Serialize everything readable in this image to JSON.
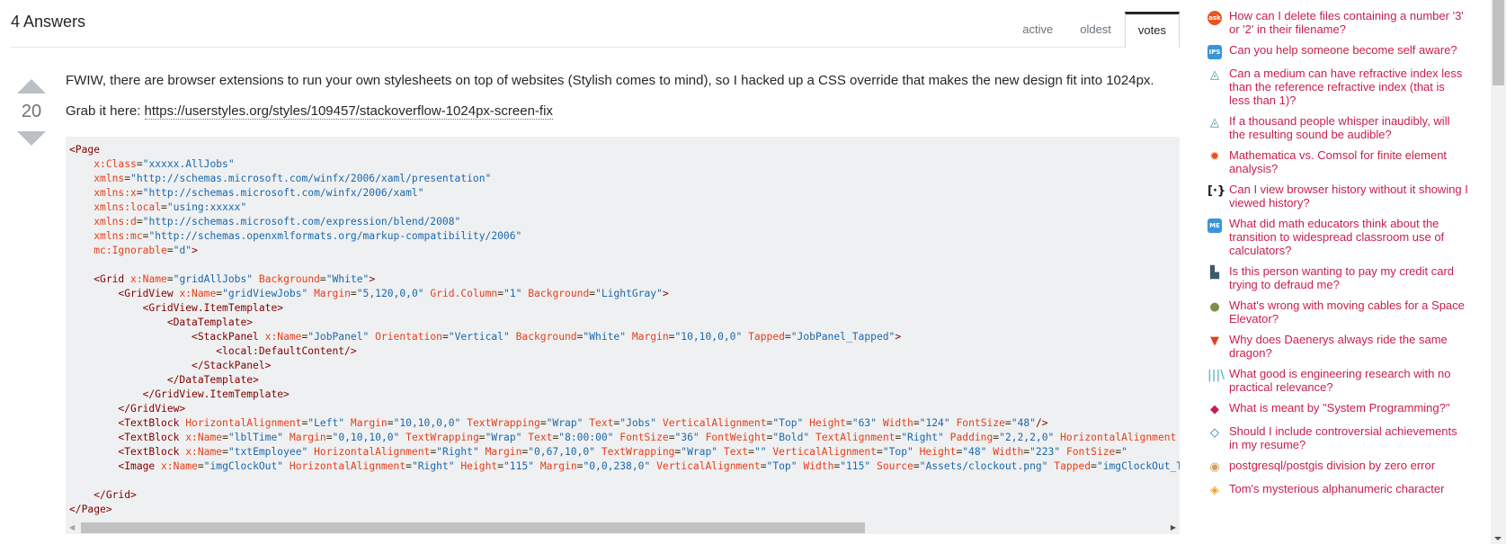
{
  "answers": {
    "title": "4 Answers",
    "tabs": [
      {
        "label": "active",
        "selected": false
      },
      {
        "label": "oldest",
        "selected": false
      },
      {
        "label": "votes",
        "selected": true
      }
    ]
  },
  "answer": {
    "vote_count": "20",
    "paragraph_1": "FWIW, there are browser extensions to run your own stylesheets on top of websites (Stylish comes to mind), so I hacked up a CSS override that makes the new design fit into 1024px.",
    "grab_prefix": "Grab it here: ",
    "link_text": "https://userstyles.org/styles/109457/stackoverflow-1024px-screen-fix",
    "code_lines": [
      [
        [
          "tg",
          "<Page"
        ]
      ],
      [
        [
          "p",
          "    "
        ],
        [
          "at",
          "x:Class"
        ],
        [
          "p",
          "="
        ],
        [
          "st",
          "\"xxxxx.AllJobs\""
        ]
      ],
      [
        [
          "p",
          "    "
        ],
        [
          "at",
          "xmlns"
        ],
        [
          "p",
          "="
        ],
        [
          "st",
          "\"http://schemas.microsoft.com/winfx/2006/xaml/presentation\""
        ]
      ],
      [
        [
          "p",
          "    "
        ],
        [
          "at",
          "xmlns:x"
        ],
        [
          "p",
          "="
        ],
        [
          "st",
          "\"http://schemas.microsoft.com/winfx/2006/xaml\""
        ]
      ],
      [
        [
          "p",
          "    "
        ],
        [
          "at",
          "xmlns:local"
        ],
        [
          "p",
          "="
        ],
        [
          "st",
          "\"using:xxxxx\""
        ]
      ],
      [
        [
          "p",
          "    "
        ],
        [
          "at",
          "xmlns:d"
        ],
        [
          "p",
          "="
        ],
        [
          "st",
          "\"http://schemas.microsoft.com/expression/blend/2008\""
        ]
      ],
      [
        [
          "p",
          "    "
        ],
        [
          "at",
          "xmlns:mc"
        ],
        [
          "p",
          "="
        ],
        [
          "st",
          "\"http://schemas.openxmlformats.org/markup-compatibility/2006\""
        ]
      ],
      [
        [
          "p",
          "    "
        ],
        [
          "at",
          "mc:Ignorable"
        ],
        [
          "p",
          "="
        ],
        [
          "st",
          "\"d\""
        ],
        [
          "tg",
          ">"
        ]
      ],
      [
        [
          "p",
          ""
        ]
      ],
      [
        [
          "p",
          "    "
        ],
        [
          "tg",
          "<Grid"
        ],
        [
          "p",
          " "
        ],
        [
          "at",
          "x:Name"
        ],
        [
          "p",
          "="
        ],
        [
          "st",
          "\"gridAllJobs\""
        ],
        [
          "p",
          " "
        ],
        [
          "at",
          "Background"
        ],
        [
          "p",
          "="
        ],
        [
          "st",
          "\"White\""
        ],
        [
          "tg",
          ">"
        ]
      ],
      [
        [
          "p",
          "        "
        ],
        [
          "tg",
          "<GridView"
        ],
        [
          "p",
          " "
        ],
        [
          "at",
          "x:Name"
        ],
        [
          "p",
          "="
        ],
        [
          "st",
          "\"gridViewJobs\""
        ],
        [
          "p",
          " "
        ],
        [
          "at",
          "Margin"
        ],
        [
          "p",
          "="
        ],
        [
          "st",
          "\"5,120,0,0\""
        ],
        [
          "p",
          " "
        ],
        [
          "at",
          "Grid.Column"
        ],
        [
          "p",
          "="
        ],
        [
          "st",
          "\"1\""
        ],
        [
          "p",
          " "
        ],
        [
          "at",
          "Background"
        ],
        [
          "p",
          "="
        ],
        [
          "st",
          "\"LightGray\""
        ],
        [
          "tg",
          ">"
        ]
      ],
      [
        [
          "p",
          "            "
        ],
        [
          "tg",
          "<GridView.ItemTemplate>"
        ]
      ],
      [
        [
          "p",
          "                "
        ],
        [
          "tg",
          "<DataTemplate>"
        ]
      ],
      [
        [
          "p",
          "                    "
        ],
        [
          "tg",
          "<StackPanel"
        ],
        [
          "p",
          " "
        ],
        [
          "at",
          "x:Name"
        ],
        [
          "p",
          "="
        ],
        [
          "st",
          "\"JobPanel\""
        ],
        [
          "p",
          " "
        ],
        [
          "at",
          "Orientation"
        ],
        [
          "p",
          "="
        ],
        [
          "st",
          "\"Vertical\""
        ],
        [
          "p",
          " "
        ],
        [
          "at",
          "Background"
        ],
        [
          "p",
          "="
        ],
        [
          "st",
          "\"White\""
        ],
        [
          "p",
          " "
        ],
        [
          "at",
          "Margin"
        ],
        [
          "p",
          "="
        ],
        [
          "st",
          "\"10,10,0,0\""
        ],
        [
          "p",
          " "
        ],
        [
          "at",
          "Tapped"
        ],
        [
          "p",
          "="
        ],
        [
          "st",
          "\"JobPanel_Tapped\""
        ],
        [
          "tg",
          ">"
        ]
      ],
      [
        [
          "p",
          "                        "
        ],
        [
          "tg",
          "<local:DefaultContent/>"
        ]
      ],
      [
        [
          "p",
          "                    "
        ],
        [
          "tg",
          "</StackPanel>"
        ]
      ],
      [
        [
          "p",
          "                "
        ],
        [
          "tg",
          "</DataTemplate>"
        ]
      ],
      [
        [
          "p",
          "            "
        ],
        [
          "tg",
          "</GridView.ItemTemplate>"
        ]
      ],
      [
        [
          "p",
          "        "
        ],
        [
          "tg",
          "</GridView>"
        ]
      ],
      [
        [
          "p",
          "        "
        ],
        [
          "tg",
          "<TextBlock"
        ],
        [
          "p",
          " "
        ],
        [
          "at",
          "HorizontalAlignment"
        ],
        [
          "p",
          "="
        ],
        [
          "st",
          "\"Left\""
        ],
        [
          "p",
          " "
        ],
        [
          "at",
          "Margin"
        ],
        [
          "p",
          "="
        ],
        [
          "st",
          "\"10,10,0,0\""
        ],
        [
          "p",
          " "
        ],
        [
          "at",
          "TextWrapping"
        ],
        [
          "p",
          "="
        ],
        [
          "st",
          "\"Wrap\""
        ],
        [
          "p",
          " "
        ],
        [
          "at",
          "Text"
        ],
        [
          "p",
          "="
        ],
        [
          "st",
          "\"Jobs\""
        ],
        [
          "p",
          " "
        ],
        [
          "at",
          "VerticalAlignment"
        ],
        [
          "p",
          "="
        ],
        [
          "st",
          "\"Top\""
        ],
        [
          "p",
          " "
        ],
        [
          "at",
          "Height"
        ],
        [
          "p",
          "="
        ],
        [
          "st",
          "\"63\""
        ],
        [
          "p",
          " "
        ],
        [
          "at",
          "Width"
        ],
        [
          "p",
          "="
        ],
        [
          "st",
          "\"124\""
        ],
        [
          "p",
          " "
        ],
        [
          "at",
          "FontSize"
        ],
        [
          "p",
          "="
        ],
        [
          "st",
          "\"48\""
        ],
        [
          "tg",
          "/>"
        ]
      ],
      [
        [
          "p",
          "        "
        ],
        [
          "tg",
          "<TextBlock"
        ],
        [
          "p",
          " "
        ],
        [
          "at",
          "x:Name"
        ],
        [
          "p",
          "="
        ],
        [
          "st",
          "\"lblTime\""
        ],
        [
          "p",
          " "
        ],
        [
          "at",
          "Margin"
        ],
        [
          "p",
          "="
        ],
        [
          "st",
          "\"0,10,10,0\""
        ],
        [
          "p",
          " "
        ],
        [
          "at",
          "TextWrapping"
        ],
        [
          "p",
          "="
        ],
        [
          "st",
          "\"Wrap\""
        ],
        [
          "p",
          " "
        ],
        [
          "at",
          "Text"
        ],
        [
          "p",
          "="
        ],
        [
          "st",
          "\"8:00:00\""
        ],
        [
          "p",
          " "
        ],
        [
          "at",
          "FontSize"
        ],
        [
          "p",
          "="
        ],
        [
          "st",
          "\"36\""
        ],
        [
          "p",
          " "
        ],
        [
          "at",
          "FontWeight"
        ],
        [
          "p",
          "="
        ],
        [
          "st",
          "\"Bold\""
        ],
        [
          "p",
          " "
        ],
        [
          "at",
          "TextAlignment"
        ],
        [
          "p",
          "="
        ],
        [
          "st",
          "\"Right\""
        ],
        [
          "p",
          " "
        ],
        [
          "at",
          "Padding"
        ],
        [
          "p",
          "="
        ],
        [
          "st",
          "\"2,2,2,0\""
        ],
        [
          "p",
          " "
        ],
        [
          "at",
          "HorizontalAlignment"
        ]
      ],
      [
        [
          "p",
          "        "
        ],
        [
          "tg",
          "<TextBlock"
        ],
        [
          "p",
          " "
        ],
        [
          "at",
          "x:Name"
        ],
        [
          "p",
          "="
        ],
        [
          "st",
          "\"txtEmployee\""
        ],
        [
          "p",
          " "
        ],
        [
          "at",
          "HorizontalAlignment"
        ],
        [
          "p",
          "="
        ],
        [
          "st",
          "\"Right\""
        ],
        [
          "p",
          " "
        ],
        [
          "at",
          "Margin"
        ],
        [
          "p",
          "="
        ],
        [
          "st",
          "\"0,67,10,0\""
        ],
        [
          "p",
          " "
        ],
        [
          "at",
          "TextWrapping"
        ],
        [
          "p",
          "="
        ],
        [
          "st",
          "\"Wrap\""
        ],
        [
          "p",
          " "
        ],
        [
          "at",
          "Text"
        ],
        [
          "p",
          "="
        ],
        [
          "st",
          "\"\""
        ],
        [
          "p",
          " "
        ],
        [
          "at",
          "VerticalAlignment"
        ],
        [
          "p",
          "="
        ],
        [
          "st",
          "\"Top\""
        ],
        [
          "p",
          " "
        ],
        [
          "at",
          "Height"
        ],
        [
          "p",
          "="
        ],
        [
          "st",
          "\"48\""
        ],
        [
          "p",
          " "
        ],
        [
          "at",
          "Width"
        ],
        [
          "p",
          "="
        ],
        [
          "st",
          "\"223\""
        ],
        [
          "p",
          " "
        ],
        [
          "at",
          "FontSize"
        ],
        [
          "p",
          "="
        ],
        [
          "st",
          "\""
        ]
      ],
      [
        [
          "p",
          "        "
        ],
        [
          "tg",
          "<Image"
        ],
        [
          "p",
          " "
        ],
        [
          "at",
          "x:Name"
        ],
        [
          "p",
          "="
        ],
        [
          "st",
          "\"imgClockOut\""
        ],
        [
          "p",
          " "
        ],
        [
          "at",
          "HorizontalAlignment"
        ],
        [
          "p",
          "="
        ],
        [
          "st",
          "\"Right\""
        ],
        [
          "p",
          " "
        ],
        [
          "at",
          "Height"
        ],
        [
          "p",
          "="
        ],
        [
          "st",
          "\"115\""
        ],
        [
          "p",
          " "
        ],
        [
          "at",
          "Margin"
        ],
        [
          "p",
          "="
        ],
        [
          "st",
          "\"0,0,238,0\""
        ],
        [
          "p",
          " "
        ],
        [
          "at",
          "VerticalAlignment"
        ],
        [
          "p",
          "="
        ],
        [
          "st",
          "\"Top\""
        ],
        [
          "p",
          " "
        ],
        [
          "at",
          "Width"
        ],
        [
          "p",
          "="
        ],
        [
          "st",
          "\"115\""
        ],
        [
          "p",
          " "
        ],
        [
          "at",
          "Source"
        ],
        [
          "p",
          "="
        ],
        [
          "st",
          "\"Assets/clockout.png\""
        ],
        [
          "p",
          " "
        ],
        [
          "at",
          "Tapped"
        ],
        [
          "p",
          "="
        ],
        [
          "st",
          "\"imgClockOut_Tapped\""
        ]
      ],
      [
        [
          "p",
          ""
        ]
      ],
      [
        [
          "p",
          "    "
        ],
        [
          "tg",
          "</Grid>"
        ]
      ],
      [
        [
          "tg",
          "</Page>"
        ]
      ]
    ]
  },
  "hot_questions": [
    {
      "icon": "askubuntu-icon",
      "glyph": "ask",
      "color": "#e95420",
      "round": true,
      "text": "How can I delete files containing a number '3' or '2' in their filename?"
    },
    {
      "icon": "interpersonal-icon",
      "glyph": "IPS",
      "color": "#3b94d9",
      "round": false,
      "text": "Can you help someone become self aware?"
    },
    {
      "icon": "physics-icon",
      "glyph": "◬",
      "color": "#4a8c9e",
      "round": false,
      "text": "Can a medium can have refractive index less than the reference refractive index (that is less than 1)?"
    },
    {
      "icon": "physics-icon",
      "glyph": "◬",
      "color": "#4a8c9e",
      "round": false,
      "text": "If a thousand people whisper inaudibly, will the resulting sound be audible?"
    },
    {
      "icon": "mathematica-icon",
      "glyph": "✹",
      "color": "#e4551d",
      "round": true,
      "text": "Mathematica vs. Comsol for finite element analysis?"
    },
    {
      "icon": "security-icon",
      "glyph": "[·}",
      "color": "#1a1a1a",
      "round": false,
      "text": "Can I view browser history without it showing I viewed history?"
    },
    {
      "icon": "matheducators-icon",
      "glyph": "ME",
      "color": "#3b94d9",
      "round": false,
      "text": "What did math educators think about the transition to widespread classroom use of calculators?"
    },
    {
      "icon": "money-icon",
      "glyph": "▙",
      "color": "#3d5b6e",
      "round": false,
      "text": "Is this person wanting to pay my credit card trying to defraud me?"
    },
    {
      "icon": "space-icon",
      "glyph": "●",
      "color": "#7c8f4b",
      "round": true,
      "text": "What's wrong with moving cables for a Space Elevator?"
    },
    {
      "icon": "movies-icon",
      "glyph": "▼",
      "color": "#e2401c",
      "round": false,
      "text": "Why does Daenerys always ride the same dragon?"
    },
    {
      "icon": "engineering-icon",
      "glyph": "|||\\",
      "color": "#6bb8c9",
      "round": false,
      "text": "What good is engineering research with no practical relevance?"
    },
    {
      "icon": "softwareengineering-icon",
      "glyph": "◆",
      "color": "#c81e4b",
      "round": false,
      "text": "What is meant by \"System Programming?\""
    },
    {
      "icon": "workplace-icon",
      "glyph": "◇",
      "color": "#1e6fb8",
      "round": false,
      "text": "Should I include controversial achievements in my resume?"
    },
    {
      "icon": "gis-icon",
      "glyph": "◉",
      "color": "#c7a35b",
      "round": true,
      "text": "postgresql/postgis division by zero error"
    },
    {
      "icon": "puzzling-icon",
      "glyph": "◈",
      "color": "#e9a23b",
      "round": false,
      "text": "Tom's mysterious alphanumeric character"
    }
  ],
  "scrollbars": {
    "horizontal_left_arrow": "◀",
    "horizontal_right_arrow": "▶"
  }
}
